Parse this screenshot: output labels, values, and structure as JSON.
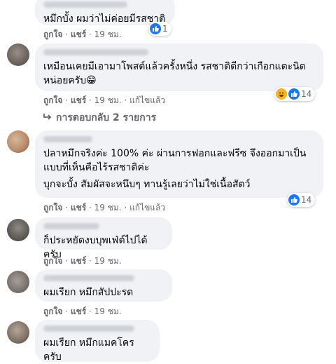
{
  "comments": [
    {
      "text": "หมึกบั้ง ผมว่าไม่ค่อยมีรสชาติ",
      "like": "ถูกใจ",
      "reply": "แชร์",
      "time": "19 ชม.",
      "reactions": "1"
    },
    {
      "text": "เหมือนเคยมีเอามาโพสต์แล้วครั้งหนึ่ง รสชาติดีกว่าเกือกแตะนิดหน่อยครับ😁",
      "like": "ถูกใจ",
      "reply": "แชร์",
      "time": "19 ชม.",
      "edited": "แก้ไขแล้ว",
      "reactions": "14"
    },
    {
      "text1": "ปลาหมึกจริงค่ะ 100% ค่ะ ผ่านการฟอกและฟรีซ จึงออกมาเป็นแบบที่เห็นคือไร้รสชาติค่ะ",
      "text2": "บุกจะบั้ง สัมผัสจะหนึบๆ ทานรู้เลยว่าไม่ใช่เนื้อสัตว์",
      "like": "ถูกใจ",
      "reply": "แชร์",
      "time": "19 ชม.",
      "edited": "แก้ไขแล้ว",
      "reactions": "14"
    },
    {
      "text": "ก็ประหยัดงบบุพเฟ่ต์ไปได้ครับ",
      "like": "ถูกใจ",
      "reply": "แชร์",
      "time": "19 ชม."
    },
    {
      "text": "ผมเรียก หมึกสัปปะรด",
      "like": "ถูกใจ",
      "reply": "แชร์",
      "time": "19 ชม."
    },
    {
      "text": "ผมเรียก หมึกแมคโคร ครับ"
    }
  ],
  "replies_link": "การตอบกลับ 2 รายการ",
  "separator": " · "
}
